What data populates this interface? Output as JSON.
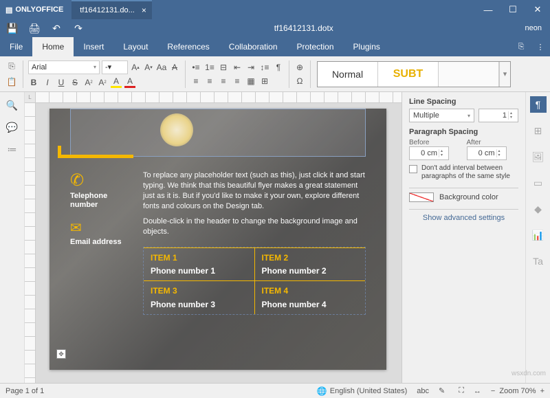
{
  "app": {
    "name": "ONLYOFFICE",
    "tab": "tf16412131.do..."
  },
  "window": {
    "min": "—",
    "max": "☐",
    "close": "✕"
  },
  "quick": {
    "doc_title": "tf16412131.dotx",
    "user": "neon"
  },
  "menu": {
    "file": "File",
    "home": "Home",
    "insert": "Insert",
    "layout": "Layout",
    "references": "References",
    "collaboration": "Collaboration",
    "protection": "Protection",
    "plugins": "Plugins"
  },
  "toolbar": {
    "font": "Arial",
    "size": "-",
    "bold": "B",
    "italic": "I",
    "underline": "U",
    "strike": "S",
    "super": "A",
    "sub": "A",
    "highlight": "A",
    "fontcolor": "A",
    "style_normal": "Normal",
    "style_subt": "SUBT",
    "incfont": "A↑",
    "decfont": "A↓",
    "case": "Aa",
    "clear": "A"
  },
  "doc": {
    "placeholder1": "To replace any placeholder text (such as this), just click it and start typing. We think that this beautiful flyer makes a great statement just as it is. But if you'd like to make it your own, explore different fonts and colours on the Design tab.",
    "placeholder2": "Double-click in the header to change the background image and objects.",
    "tel_label": "Telephone number",
    "email_label": "Email address",
    "items": [
      {
        "title": "ITEM 1",
        "phone": "Phone number 1"
      },
      {
        "title": "ITEM 2",
        "phone": "Phone number 2"
      },
      {
        "title": "ITEM 3",
        "phone": "Phone number 3"
      },
      {
        "title": "ITEM 4",
        "phone": "Phone number 4"
      }
    ]
  },
  "panel": {
    "line_spacing": "Line Spacing",
    "multiple": "Multiple",
    "value": "1",
    "para_spacing": "Paragraph Spacing",
    "before": "Before",
    "after": "After",
    "before_val": "0 cm",
    "after_val": "0 cm",
    "nointerval": "Don't add interval between paragraphs of the same style",
    "bgcolor": "Background color",
    "advanced": "Show advanced settings"
  },
  "status": {
    "page": "Page 1 of 1",
    "lang": "English (United States)",
    "zoom": "Zoom 70%",
    "minus": "−",
    "plus": "+"
  },
  "watermark": "wsxdn.com"
}
